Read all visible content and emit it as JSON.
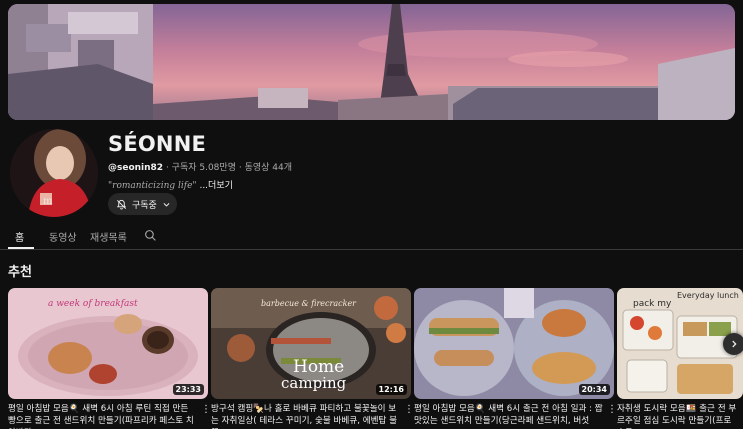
{
  "channel": {
    "name": "SÉONNE",
    "handle": "@seonin82",
    "separator": " · ",
    "subscribers": "구독자 5.08만명",
    "video_count": "동영상 44개",
    "description": "\"romanticizing life\"",
    "more_label": "...더보기",
    "subscribe_label": "구독중"
  },
  "tabs": [
    {
      "label": "홈",
      "active": true
    },
    {
      "label": "동영상",
      "active": false
    },
    {
      "label": "재생목록",
      "active": false
    }
  ],
  "section_title": "추천",
  "videos": [
    {
      "title": "평일 아침밥 모음🍳 새벽 6시 아침 루틴 직접 만든 빵으로 출근 전 샌드위치 만들기(파프리카 페스토 치아바타",
      "duration": "23:33",
      "thumb_text": "a week of breakfast"
    },
    {
      "title": "방구석 캠핑🍢나 홀로 바베큐 파티하고 불꽃놀이 보는 자취일상( 테라스 꾸미기, 숯불 바베큐, 에벤탑 불꽃",
      "duration": "12:16",
      "thumb_text_top": "barbecue & firecracker",
      "thumb_text_main1": "Home",
      "thumb_text_main2": "camping"
    },
    {
      "title": "평일 아침밥 모음🍳 새벽 6시 출근 전 아침 일과 : 짭맛있는 샌드위치 만들기(당근라페 샌드위치, 버섯",
      "duration": "20:34"
    },
    {
      "title": "자취생 도시락 모음🍱 출근 전 부르주일 점심 도시락 만들기(프로슈토",
      "thumb_text1": "pack my",
      "thumb_text2": "Everyday lunch"
    }
  ],
  "colors": {
    "background": "#0f0f0f",
    "text_primary": "#f1f1f1",
    "text_secondary": "#aaaaaa",
    "button_bg": "#272727"
  }
}
